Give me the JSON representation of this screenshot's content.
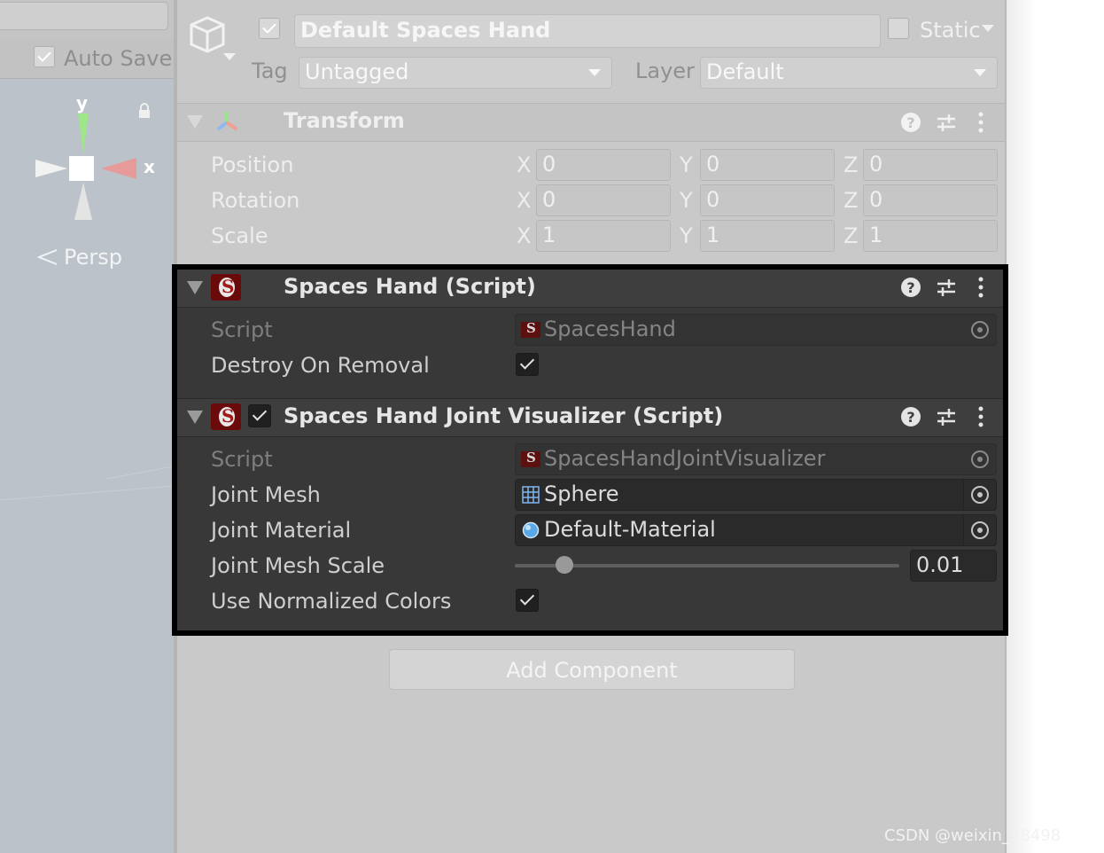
{
  "scene": {
    "auto_save_label": "Auto Save",
    "auto_save_checked": true,
    "gizmo_y": "y",
    "gizmo_x": "x",
    "persp_label": "Persp"
  },
  "game_object": {
    "active": true,
    "name": "Default Spaces Hand",
    "static_label": "Static",
    "tag_label": "Tag",
    "tag_value": "Untagged",
    "layer_label": "Layer",
    "layer_value": "Default"
  },
  "transform": {
    "title": "Transform",
    "rows": [
      {
        "label": "Position",
        "x": "0",
        "y": "0",
        "z": "0"
      },
      {
        "label": "Rotation",
        "x": "0",
        "y": "0",
        "z": "0"
      },
      {
        "label": "Scale",
        "x": "1",
        "y": "1",
        "z": "1"
      }
    ],
    "axis_x": "X",
    "axis_y": "Y",
    "axis_z": "Z"
  },
  "spaces_hand": {
    "title": "Spaces Hand (Script)",
    "script_label": "Script",
    "script_value": "SpacesHand",
    "destroy_label": "Destroy On Removal",
    "destroy_checked": true
  },
  "joint_visualizer": {
    "title": "Spaces Hand Joint Visualizer (Script)",
    "enabled": true,
    "script_label": "Script",
    "script_value": "SpacesHandJointVisualizer",
    "mesh_label": "Joint Mesh",
    "mesh_value": "Sphere",
    "material_label": "Joint Material",
    "material_value": "Default-Material",
    "scale_label": "Joint Mesh Scale",
    "scale_value": "0.01",
    "normalized_label": "Use Normalized Colors",
    "normalized_checked": true
  },
  "add_component_label": "Add Component",
  "watermark": "CSDN @weixin_38498",
  "colors": {
    "inspector_bg": "#c9c9c9",
    "dark_panel": "#383838",
    "highlight_border": "#000000",
    "scene_bg": "#bcc2c9"
  }
}
